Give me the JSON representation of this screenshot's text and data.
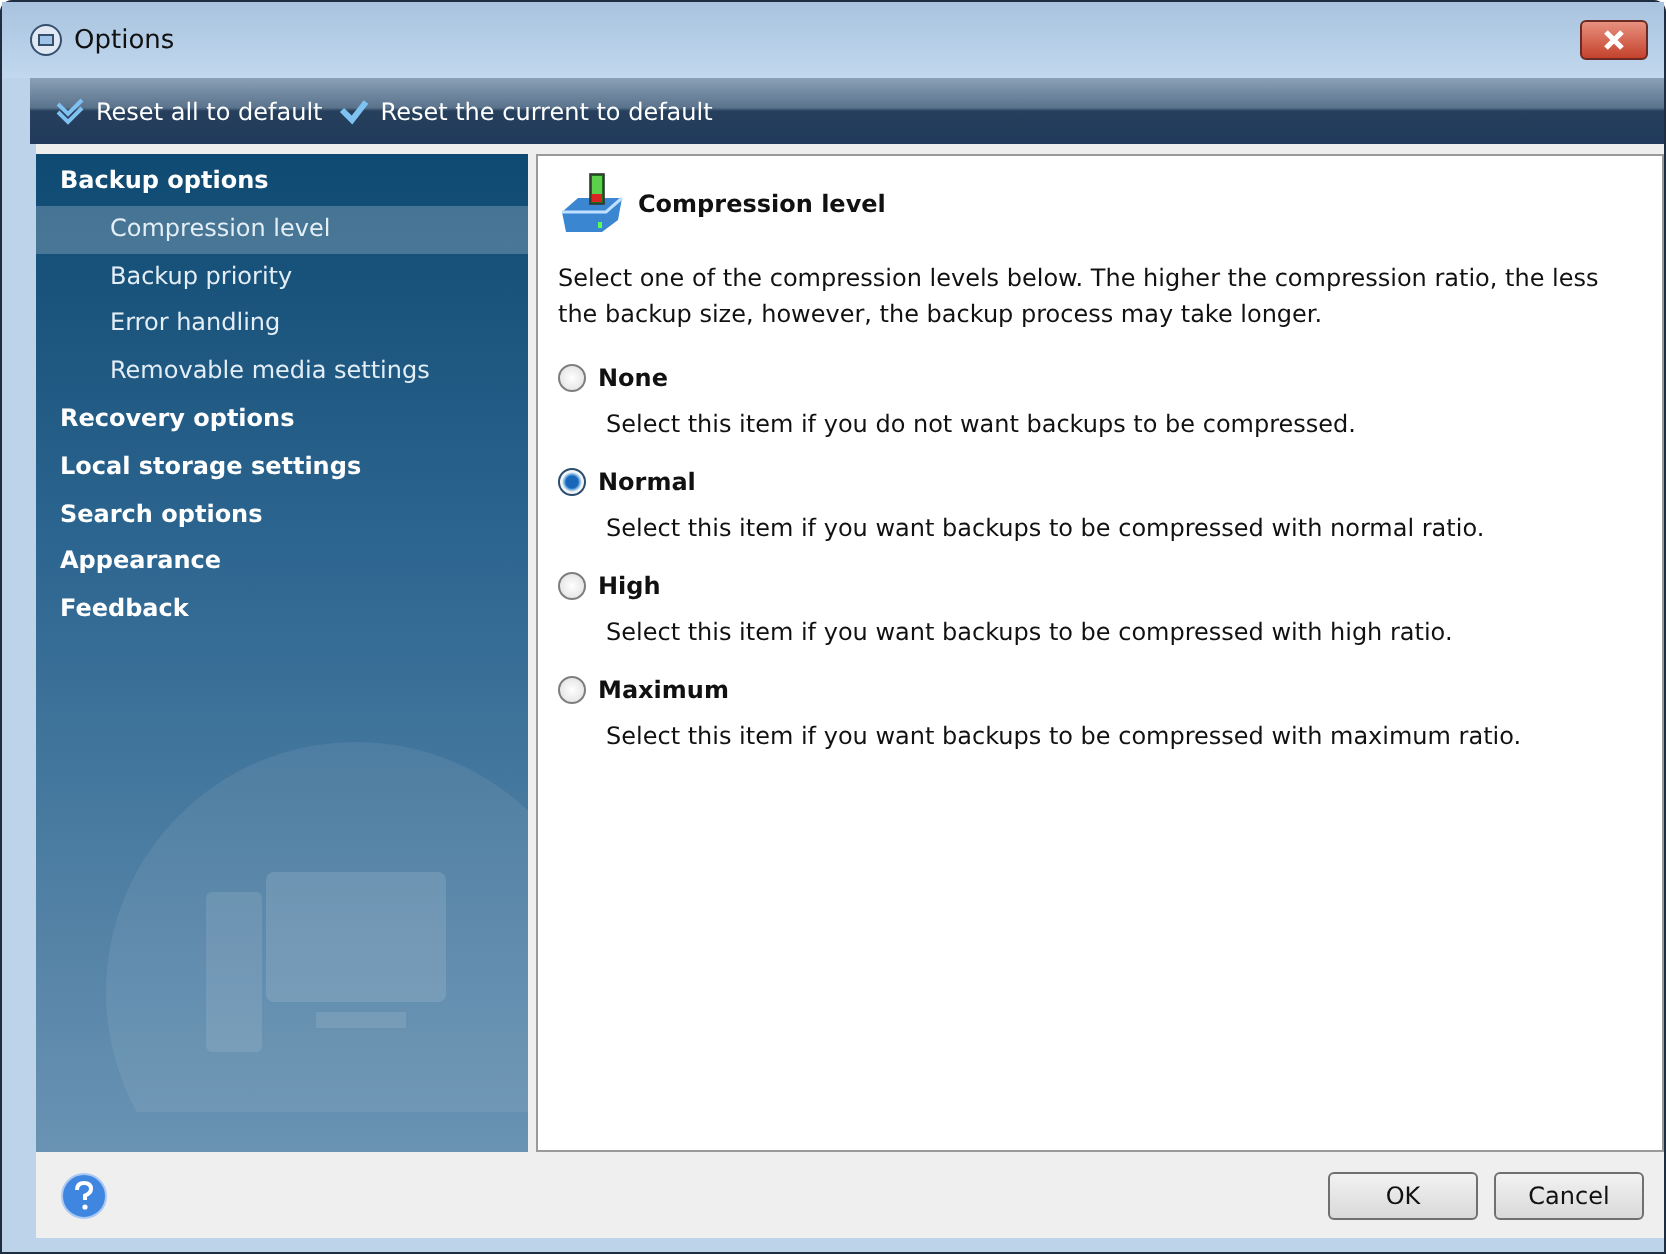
{
  "window": {
    "title": "Options"
  },
  "toolbar": [
    {
      "label": "Reset all to default",
      "kind": "double"
    },
    {
      "label": "Reset the current to default",
      "kind": "single"
    }
  ],
  "sidebar": {
    "items": [
      {
        "label": "Backup options",
        "selected": false,
        "children": [
          {
            "label": "Compression level",
            "selected": true
          },
          {
            "label": "Backup priority",
            "selected": false
          },
          {
            "label": "Error handling",
            "selected": false
          },
          {
            "label": "Removable media settings",
            "selected": false
          }
        ]
      },
      {
        "label": "Recovery options",
        "selected": false
      },
      {
        "label": "Local storage settings",
        "selected": false
      },
      {
        "label": "Search options",
        "selected": false
      },
      {
        "label": "Appearance",
        "selected": false
      },
      {
        "label": "Feedback",
        "selected": false
      }
    ]
  },
  "content": {
    "heading": "Compression level",
    "description": "Select one of the compression levels below. The higher the compression ratio, the less the backup size, however, the backup process may take longer.",
    "options": [
      {
        "label": "None",
        "description": "Select this item if you do not want backups to be compressed.",
        "selected": false
      },
      {
        "label": "Normal",
        "description": "Select this item if you want backups to be compressed with normal ratio.",
        "selected": true
      },
      {
        "label": "High",
        "description": "Select this item if you want backups to be compressed with high ratio.",
        "selected": false
      },
      {
        "label": "Maximum",
        "description": "Select this item if you want backups to be compressed with maximum ratio.",
        "selected": false
      }
    ]
  },
  "buttons": [
    "OK",
    "Cancel"
  ]
}
